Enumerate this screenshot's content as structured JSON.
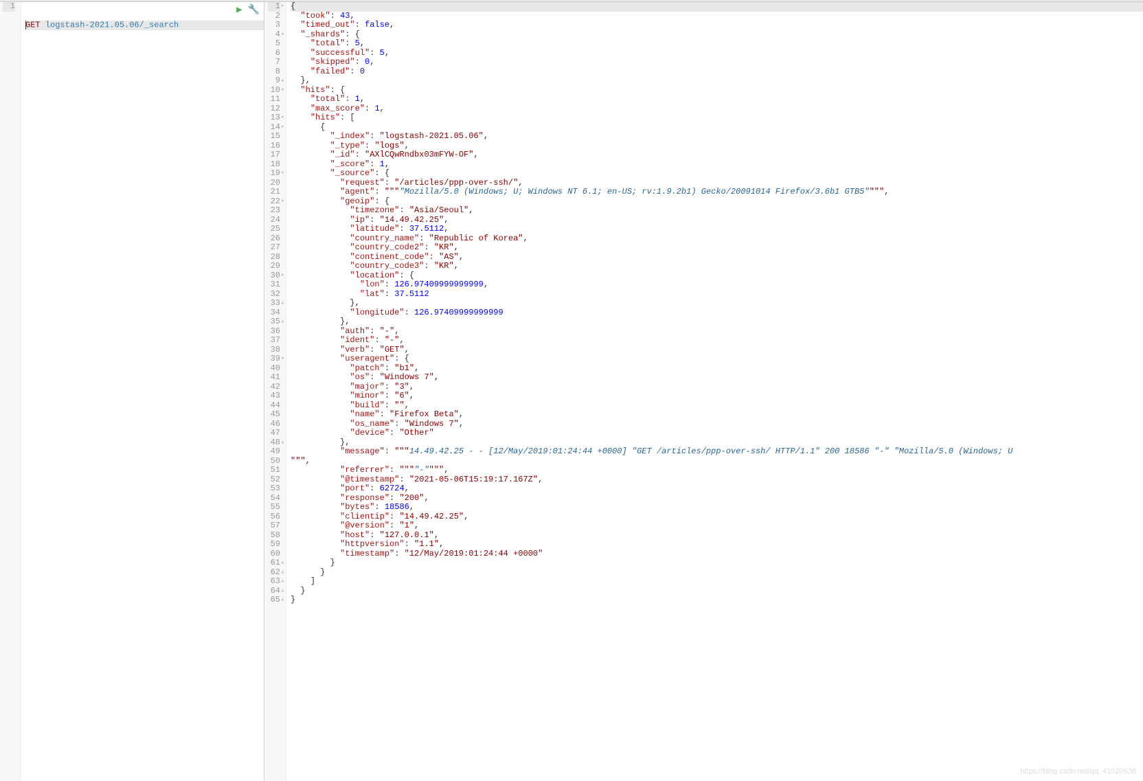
{
  "request_line": {
    "method": "GET",
    "path": "logstash-2021.05.06/_search"
  },
  "response_lines": [
    {
      "n": 1,
      "fold": "▾",
      "segs": [
        [
          "punc",
          "{"
        ]
      ]
    },
    {
      "n": 2,
      "segs": [
        [
          "pad",
          "  "
        ],
        [
          "key",
          "\"took\""
        ],
        [
          "punc",
          ": "
        ],
        [
          "num",
          "43"
        ],
        [
          "punc",
          ","
        ]
      ]
    },
    {
      "n": 3,
      "segs": [
        [
          "pad",
          "  "
        ],
        [
          "key",
          "\"timed_out\""
        ],
        [
          "punc",
          ": "
        ],
        [
          "bool",
          "false"
        ],
        [
          "punc",
          ","
        ]
      ]
    },
    {
      "n": 4,
      "fold": "▾",
      "segs": [
        [
          "pad",
          "  "
        ],
        [
          "key",
          "\"_shards\""
        ],
        [
          "punc",
          ": {"
        ]
      ]
    },
    {
      "n": 5,
      "segs": [
        [
          "pad",
          "    "
        ],
        [
          "key",
          "\"total\""
        ],
        [
          "punc",
          ": "
        ],
        [
          "num",
          "5"
        ],
        [
          "punc",
          ","
        ]
      ]
    },
    {
      "n": 6,
      "segs": [
        [
          "pad",
          "    "
        ],
        [
          "key",
          "\"successful\""
        ],
        [
          "punc",
          ": "
        ],
        [
          "num",
          "5"
        ],
        [
          "punc",
          ","
        ]
      ]
    },
    {
      "n": 7,
      "segs": [
        [
          "pad",
          "    "
        ],
        [
          "key",
          "\"skipped\""
        ],
        [
          "punc",
          ": "
        ],
        [
          "num",
          "0"
        ],
        [
          "punc",
          ","
        ]
      ]
    },
    {
      "n": 8,
      "segs": [
        [
          "pad",
          "    "
        ],
        [
          "key",
          "\"failed\""
        ],
        [
          "punc",
          ": "
        ],
        [
          "num",
          "0"
        ]
      ]
    },
    {
      "n": 9,
      "fold": "▴",
      "segs": [
        [
          "pad",
          "  "
        ],
        [
          "punc",
          "},"
        ]
      ]
    },
    {
      "n": 10,
      "fold": "▾",
      "segs": [
        [
          "pad",
          "  "
        ],
        [
          "key",
          "\"hits\""
        ],
        [
          "punc",
          ": {"
        ]
      ]
    },
    {
      "n": 11,
      "segs": [
        [
          "pad",
          "    "
        ],
        [
          "key",
          "\"total\""
        ],
        [
          "punc",
          ": "
        ],
        [
          "num",
          "1"
        ],
        [
          "punc",
          ","
        ]
      ]
    },
    {
      "n": 12,
      "segs": [
        [
          "pad",
          "    "
        ],
        [
          "key",
          "\"max_score\""
        ],
        [
          "punc",
          ": "
        ],
        [
          "num",
          "1"
        ],
        [
          "punc",
          ","
        ]
      ]
    },
    {
      "n": 13,
      "fold": "▾",
      "segs": [
        [
          "pad",
          "    "
        ],
        [
          "key",
          "\"hits\""
        ],
        [
          "punc",
          ": ["
        ]
      ]
    },
    {
      "n": 14,
      "fold": "▾",
      "segs": [
        [
          "pad",
          "      "
        ],
        [
          "punc",
          "{"
        ]
      ]
    },
    {
      "n": 15,
      "segs": [
        [
          "pad",
          "        "
        ],
        [
          "key",
          "\"_index\""
        ],
        [
          "punc",
          ": "
        ],
        [
          "str",
          "\"logstash-2021.05.06\""
        ],
        [
          "punc",
          ","
        ]
      ]
    },
    {
      "n": 16,
      "segs": [
        [
          "pad",
          "        "
        ],
        [
          "key",
          "\"_type\""
        ],
        [
          "punc",
          ": "
        ],
        [
          "str",
          "\"logs\""
        ],
        [
          "punc",
          ","
        ]
      ]
    },
    {
      "n": 17,
      "segs": [
        [
          "pad",
          "        "
        ],
        [
          "key",
          "\"_id\""
        ],
        [
          "punc",
          ": "
        ],
        [
          "str",
          "\"AXlCQwRndbx03mFYW-OF\""
        ],
        [
          "punc",
          ","
        ]
      ]
    },
    {
      "n": 18,
      "segs": [
        [
          "pad",
          "        "
        ],
        [
          "key",
          "\"_score\""
        ],
        [
          "punc",
          ": "
        ],
        [
          "num",
          "1"
        ],
        [
          "punc",
          ","
        ]
      ]
    },
    {
      "n": 19,
      "fold": "▾",
      "segs": [
        [
          "pad",
          "        "
        ],
        [
          "key",
          "\"_source\""
        ],
        [
          "punc",
          ": {"
        ]
      ]
    },
    {
      "n": 20,
      "segs": [
        [
          "pad",
          "          "
        ],
        [
          "key",
          "\"request\""
        ],
        [
          "punc",
          ": "
        ],
        [
          "str",
          "\"/articles/ppp-over-ssh/\""
        ],
        [
          "punc",
          ","
        ]
      ]
    },
    {
      "n": 21,
      "segs": [
        [
          "pad",
          "          "
        ],
        [
          "key",
          "\"agent\""
        ],
        [
          "punc",
          ": "
        ],
        [
          "str",
          "\"\"\""
        ],
        [
          "strit",
          "\"Mozilla/5.0 (Windows; U; Windows NT 6.1; en-US; rv:1.9.2b1) Gecko/20091014 Firefox/3.6b1 GTB5\""
        ],
        [
          "str",
          "\"\"\""
        ],
        [
          "punc",
          ","
        ]
      ]
    },
    {
      "n": 22,
      "fold": "▾",
      "segs": [
        [
          "pad",
          "          "
        ],
        [
          "key",
          "\"geoip\""
        ],
        [
          "punc",
          ": {"
        ]
      ]
    },
    {
      "n": 23,
      "segs": [
        [
          "pad",
          "            "
        ],
        [
          "key",
          "\"timezone\""
        ],
        [
          "punc",
          ": "
        ],
        [
          "str",
          "\"Asia/Seoul\""
        ],
        [
          "punc",
          ","
        ]
      ]
    },
    {
      "n": 24,
      "segs": [
        [
          "pad",
          "            "
        ],
        [
          "key",
          "\"ip\""
        ],
        [
          "punc",
          ": "
        ],
        [
          "str",
          "\"14.49.42.25\""
        ],
        [
          "punc",
          ","
        ]
      ]
    },
    {
      "n": 25,
      "segs": [
        [
          "pad",
          "            "
        ],
        [
          "key",
          "\"latitude\""
        ],
        [
          "punc",
          ": "
        ],
        [
          "num",
          "37.5112"
        ],
        [
          "punc",
          ","
        ]
      ]
    },
    {
      "n": 26,
      "segs": [
        [
          "pad",
          "            "
        ],
        [
          "key",
          "\"country_name\""
        ],
        [
          "punc",
          ": "
        ],
        [
          "str",
          "\"Republic of Korea\""
        ],
        [
          "punc",
          ","
        ]
      ]
    },
    {
      "n": 27,
      "segs": [
        [
          "pad",
          "            "
        ],
        [
          "key",
          "\"country_code2\""
        ],
        [
          "punc",
          ": "
        ],
        [
          "str",
          "\"KR\""
        ],
        [
          "punc",
          ","
        ]
      ]
    },
    {
      "n": 28,
      "segs": [
        [
          "pad",
          "            "
        ],
        [
          "key",
          "\"continent_code\""
        ],
        [
          "punc",
          ": "
        ],
        [
          "str",
          "\"AS\""
        ],
        [
          "punc",
          ","
        ]
      ]
    },
    {
      "n": 29,
      "segs": [
        [
          "pad",
          "            "
        ],
        [
          "key",
          "\"country_code3\""
        ],
        [
          "punc",
          ": "
        ],
        [
          "str",
          "\"KR\""
        ],
        [
          "punc",
          ","
        ]
      ]
    },
    {
      "n": 30,
      "fold": "▾",
      "segs": [
        [
          "pad",
          "            "
        ],
        [
          "key",
          "\"location\""
        ],
        [
          "punc",
          ": {"
        ]
      ]
    },
    {
      "n": 31,
      "segs": [
        [
          "pad",
          "              "
        ],
        [
          "key",
          "\"lon\""
        ],
        [
          "punc",
          ": "
        ],
        [
          "num",
          "126.97409999999999"
        ],
        [
          "punc",
          ","
        ]
      ]
    },
    {
      "n": 32,
      "segs": [
        [
          "pad",
          "              "
        ],
        [
          "key",
          "\"lat\""
        ],
        [
          "punc",
          ": "
        ],
        [
          "num",
          "37.5112"
        ]
      ]
    },
    {
      "n": 33,
      "fold": "▴",
      "segs": [
        [
          "pad",
          "            "
        ],
        [
          "punc",
          "},"
        ]
      ]
    },
    {
      "n": 34,
      "segs": [
        [
          "pad",
          "            "
        ],
        [
          "key",
          "\"longitude\""
        ],
        [
          "punc",
          ": "
        ],
        [
          "num",
          "126.97409999999999"
        ]
      ]
    },
    {
      "n": 35,
      "fold": "▴",
      "segs": [
        [
          "pad",
          "          "
        ],
        [
          "punc",
          "},"
        ]
      ]
    },
    {
      "n": 36,
      "segs": [
        [
          "pad",
          "          "
        ],
        [
          "key",
          "\"auth\""
        ],
        [
          "punc",
          ": "
        ],
        [
          "str",
          "\"-\""
        ],
        [
          "punc",
          ","
        ]
      ]
    },
    {
      "n": 37,
      "segs": [
        [
          "pad",
          "          "
        ],
        [
          "key",
          "\"ident\""
        ],
        [
          "punc",
          ": "
        ],
        [
          "str",
          "\"-\""
        ],
        [
          "punc",
          ","
        ]
      ]
    },
    {
      "n": 38,
      "segs": [
        [
          "pad",
          "          "
        ],
        [
          "key",
          "\"verb\""
        ],
        [
          "punc",
          ": "
        ],
        [
          "str",
          "\"GET\""
        ],
        [
          "punc",
          ","
        ]
      ]
    },
    {
      "n": 39,
      "fold": "▾",
      "segs": [
        [
          "pad",
          "          "
        ],
        [
          "key",
          "\"useragent\""
        ],
        [
          "punc",
          ": {"
        ]
      ]
    },
    {
      "n": 40,
      "segs": [
        [
          "pad",
          "            "
        ],
        [
          "key",
          "\"patch\""
        ],
        [
          "punc",
          ": "
        ],
        [
          "str",
          "\"b1\""
        ],
        [
          "punc",
          ","
        ]
      ]
    },
    {
      "n": 41,
      "segs": [
        [
          "pad",
          "            "
        ],
        [
          "key",
          "\"os\""
        ],
        [
          "punc",
          ": "
        ],
        [
          "str",
          "\"Windows 7\""
        ],
        [
          "punc",
          ","
        ]
      ]
    },
    {
      "n": 42,
      "segs": [
        [
          "pad",
          "            "
        ],
        [
          "key",
          "\"major\""
        ],
        [
          "punc",
          ": "
        ],
        [
          "str",
          "\"3\""
        ],
        [
          "punc",
          ","
        ]
      ]
    },
    {
      "n": 43,
      "segs": [
        [
          "pad",
          "            "
        ],
        [
          "key",
          "\"minor\""
        ],
        [
          "punc",
          ": "
        ],
        [
          "str",
          "\"6\""
        ],
        [
          "punc",
          ","
        ]
      ]
    },
    {
      "n": 44,
      "segs": [
        [
          "pad",
          "            "
        ],
        [
          "key",
          "\"build\""
        ],
        [
          "punc",
          ": "
        ],
        [
          "str",
          "\"\""
        ],
        [
          "punc",
          ","
        ]
      ]
    },
    {
      "n": 45,
      "segs": [
        [
          "pad",
          "            "
        ],
        [
          "key",
          "\"name\""
        ],
        [
          "punc",
          ": "
        ],
        [
          "str",
          "\"Firefox Beta\""
        ],
        [
          "punc",
          ","
        ]
      ]
    },
    {
      "n": 46,
      "segs": [
        [
          "pad",
          "            "
        ],
        [
          "key",
          "\"os_name\""
        ],
        [
          "punc",
          ": "
        ],
        [
          "str",
          "\"Windows 7\""
        ],
        [
          "punc",
          ","
        ]
      ]
    },
    {
      "n": 47,
      "segs": [
        [
          "pad",
          "            "
        ],
        [
          "key",
          "\"device\""
        ],
        [
          "punc",
          ": "
        ],
        [
          "str",
          "\"Other\""
        ]
      ]
    },
    {
      "n": 48,
      "fold": "▴",
      "segs": [
        [
          "pad",
          "          "
        ],
        [
          "punc",
          "},"
        ]
      ]
    },
    {
      "n": 49,
      "segs": [
        [
          "pad",
          "          "
        ],
        [
          "key",
          "\"message\""
        ],
        [
          "punc",
          ": "
        ],
        [
          "str",
          "\"\"\""
        ],
        [
          "strit",
          "14.49.42.25 - - [12/May/2019:01:24:44 +0000] \"GET /articles/ppp-over-ssh/ HTTP/1.1\" 200 18586 \"-\" \"Mozilla/5.0 (Windows; U"
        ]
      ]
    },
    {
      "n": 50,
      "segs": [
        [
          "str",
          "\"\"\""
        ],
        [
          "punc",
          ","
        ]
      ]
    },
    {
      "n": 51,
      "segs": [
        [
          "pad",
          "          "
        ],
        [
          "key",
          "\"referrer\""
        ],
        [
          "punc",
          ": "
        ],
        [
          "str",
          "\"\"\""
        ],
        [
          "strit",
          "\"-\""
        ],
        [
          "str",
          "\"\"\""
        ],
        [
          "punc",
          ","
        ]
      ]
    },
    {
      "n": 52,
      "segs": [
        [
          "pad",
          "          "
        ],
        [
          "key",
          "\"@timestamp\""
        ],
        [
          "punc",
          ": "
        ],
        [
          "str",
          "\"2021-05-06T15:19:17.167Z\""
        ],
        [
          "punc",
          ","
        ]
      ]
    },
    {
      "n": 53,
      "segs": [
        [
          "pad",
          "          "
        ],
        [
          "key",
          "\"port\""
        ],
        [
          "punc",
          ": "
        ],
        [
          "num",
          "62724"
        ],
        [
          "punc",
          ","
        ]
      ]
    },
    {
      "n": 54,
      "segs": [
        [
          "pad",
          "          "
        ],
        [
          "key",
          "\"response\""
        ],
        [
          "punc",
          ": "
        ],
        [
          "str",
          "\"200\""
        ],
        [
          "punc",
          ","
        ]
      ]
    },
    {
      "n": 55,
      "segs": [
        [
          "pad",
          "          "
        ],
        [
          "key",
          "\"bytes\""
        ],
        [
          "punc",
          ": "
        ],
        [
          "num",
          "18586"
        ],
        [
          "punc",
          ","
        ]
      ]
    },
    {
      "n": 56,
      "segs": [
        [
          "pad",
          "          "
        ],
        [
          "key",
          "\"clientip\""
        ],
        [
          "punc",
          ": "
        ],
        [
          "str",
          "\"14.49.42.25\""
        ],
        [
          "punc",
          ","
        ]
      ]
    },
    {
      "n": 57,
      "segs": [
        [
          "pad",
          "          "
        ],
        [
          "key",
          "\"@version\""
        ],
        [
          "punc",
          ": "
        ],
        [
          "str",
          "\"1\""
        ],
        [
          "punc",
          ","
        ]
      ]
    },
    {
      "n": 58,
      "segs": [
        [
          "pad",
          "          "
        ],
        [
          "key",
          "\"host\""
        ],
        [
          "punc",
          ": "
        ],
        [
          "str",
          "\"127.0.0.1\""
        ],
        [
          "punc",
          ","
        ]
      ]
    },
    {
      "n": 59,
      "segs": [
        [
          "pad",
          "          "
        ],
        [
          "key",
          "\"httpversion\""
        ],
        [
          "punc",
          ": "
        ],
        [
          "str",
          "\"1.1\""
        ],
        [
          "punc",
          ","
        ]
      ]
    },
    {
      "n": 60,
      "segs": [
        [
          "pad",
          "          "
        ],
        [
          "key",
          "\"timestamp\""
        ],
        [
          "punc",
          ": "
        ],
        [
          "str",
          "\"12/May/2019:01:24:44 +0000\""
        ]
      ]
    },
    {
      "n": 61,
      "fold": "▴",
      "segs": [
        [
          "pad",
          "        "
        ],
        [
          "punc",
          "}"
        ]
      ]
    },
    {
      "n": 62,
      "fold": "▴",
      "segs": [
        [
          "pad",
          "      "
        ],
        [
          "punc",
          "}"
        ]
      ]
    },
    {
      "n": 63,
      "fold": "▴",
      "segs": [
        [
          "pad",
          "    "
        ],
        [
          "punc",
          "]"
        ]
      ]
    },
    {
      "n": 64,
      "fold": "▴",
      "segs": [
        [
          "pad",
          "  "
        ],
        [
          "punc",
          "}"
        ]
      ]
    },
    {
      "n": 65,
      "fold": "▴",
      "segs": [
        [
          "punc",
          "}"
        ]
      ]
    }
  ],
  "watermark": "https://blog.csdn.net/qq_41520636"
}
